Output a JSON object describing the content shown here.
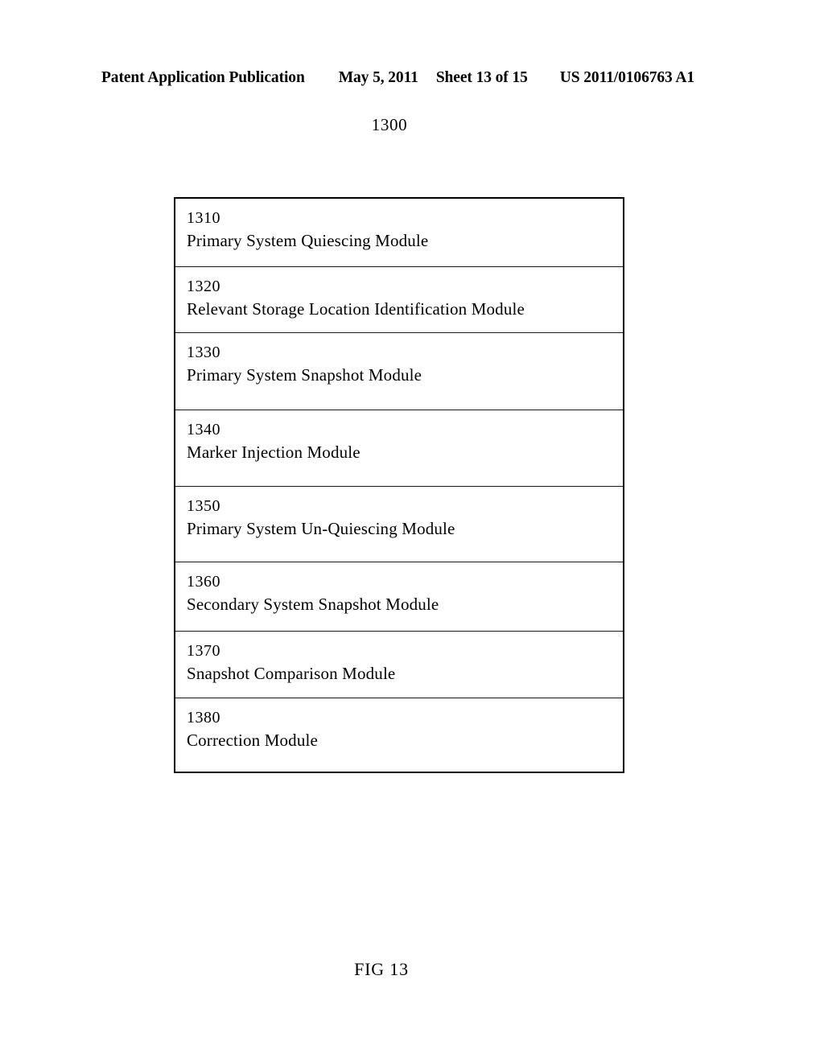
{
  "header": {
    "publication": "Patent Application Publication",
    "date": "May 5, 2011",
    "sheet": "Sheet 13 of 15",
    "document_number": "US 2011/0106763 A1"
  },
  "figure": {
    "reference_numeral": "1300",
    "caption": "FIG 13"
  },
  "diagram_data": {
    "type": "block-stack",
    "title": "1300",
    "modules": [
      {
        "ref": "1310",
        "label": "Primary System Quiescing Module"
      },
      {
        "ref": "1320",
        "label": "Relevant Storage Location Identification Module"
      },
      {
        "ref": "1330",
        "label": "Primary System Snapshot Module"
      },
      {
        "ref": "1340",
        "label": "Marker Injection Module"
      },
      {
        "ref": "1350",
        "label": "Primary System Un-Quiescing Module"
      },
      {
        "ref": "1360",
        "label": "Secondary System Snapshot Module"
      },
      {
        "ref": "1370",
        "label": "Snapshot Comparison Module"
      },
      {
        "ref": "1380",
        "label": "Correction Module"
      }
    ]
  }
}
